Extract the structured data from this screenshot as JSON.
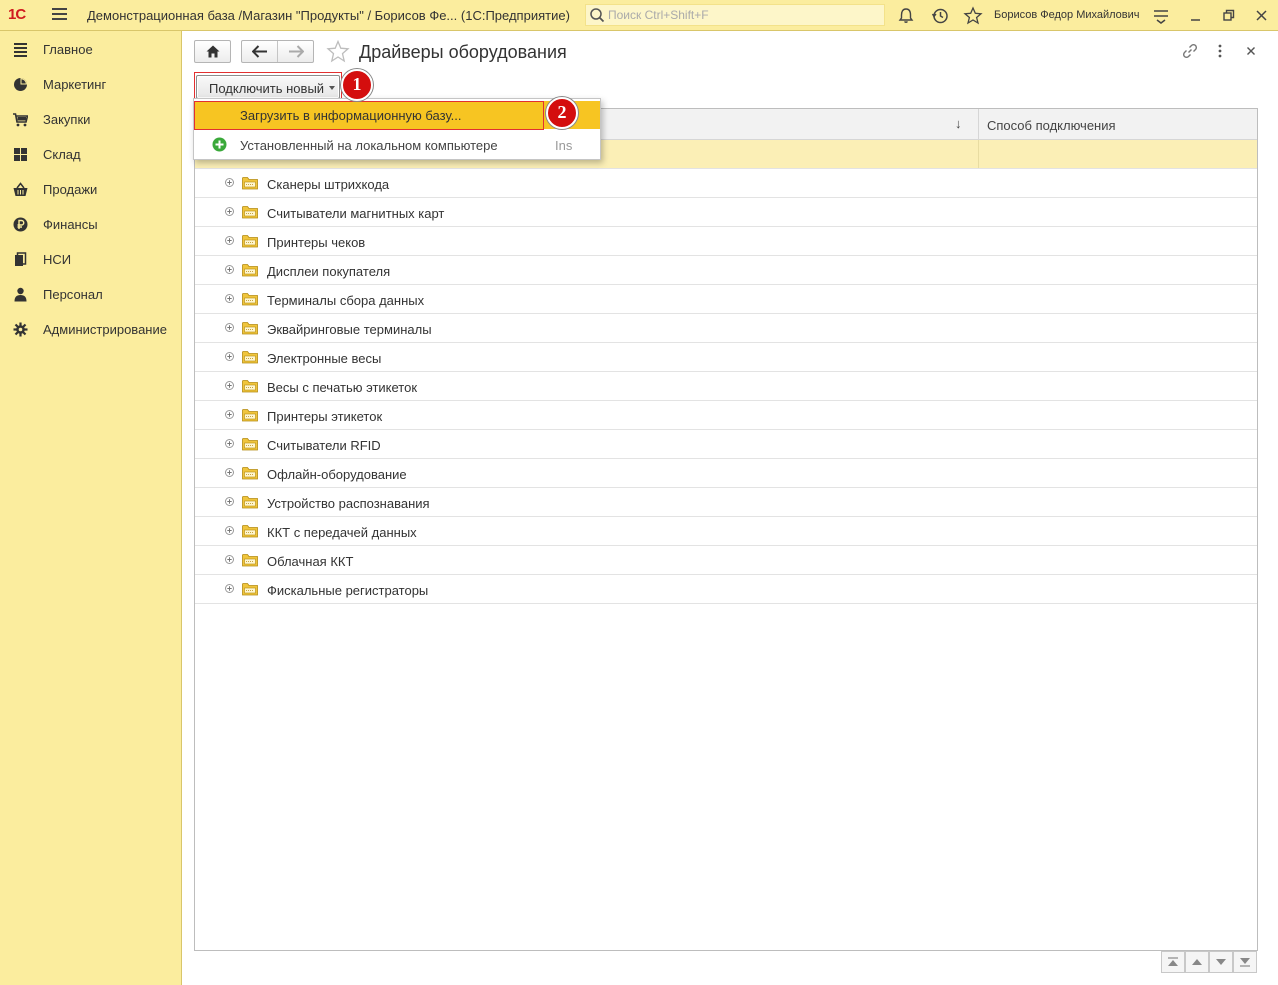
{
  "app": {
    "logo": "1С",
    "window_title": "Демонстрационная база /Магазин \"Продукты\" / Борисов Фе...  (1С:Предприятие)",
    "search_placeholder": "Поиск Ctrl+Shift+F",
    "user_name": "Борисов Федор Михайлович"
  },
  "sidebar": {
    "items": [
      {
        "label": "Главное",
        "icon": "menu-lines-icon"
      },
      {
        "label": "Маркетинг",
        "icon": "pie-chart-icon"
      },
      {
        "label": "Закупки",
        "icon": "cart-icon"
      },
      {
        "label": "Склад",
        "icon": "warehouse-grid-icon"
      },
      {
        "label": "Продажи",
        "icon": "basket-icon"
      },
      {
        "label": "Финансы",
        "icon": "ruble-coin-icon"
      },
      {
        "label": "НСИ",
        "icon": "reference-books-icon"
      },
      {
        "label": "Персонал",
        "icon": "person-icon"
      },
      {
        "label": "Администрирование",
        "icon": "gear-icon"
      }
    ]
  },
  "page": {
    "title": "Драйверы оборудования",
    "connect_button_label": "Подключить новый"
  },
  "markers": {
    "one": "1",
    "two": "2"
  },
  "menu": {
    "item_upload": "Загрузить в информационную базу...",
    "item_installed": "Установленный на локальном компьютере",
    "item_installed_shortcut": "Ins"
  },
  "table": {
    "columns": {
      "sort_indicator": "↓",
      "connection_method": "Способ подключения"
    },
    "rows": [
      "Сканеры штрихкода",
      "Считыватели магнитных карт",
      "Принтеры чеков",
      "Дисплеи покупателя",
      "Терминалы сбора данных",
      "Эквайринговые терминалы",
      "Электронные весы",
      "Весы с печатью этикеток",
      "Принтеры этикеток",
      "Считыватели RFID",
      "Офлайн-оборудование",
      "Устройство распознавания",
      "ККТ с передачей данных",
      "Облачная ККТ",
      "Фискальные регистраторы"
    ]
  },
  "colors": {
    "panel_yellow": "#fbed9e",
    "menu_highlight": "#f7c522",
    "selected_row": "#fbefb6",
    "marker_red": "#d40e0e",
    "frame_red": "#e23030"
  }
}
